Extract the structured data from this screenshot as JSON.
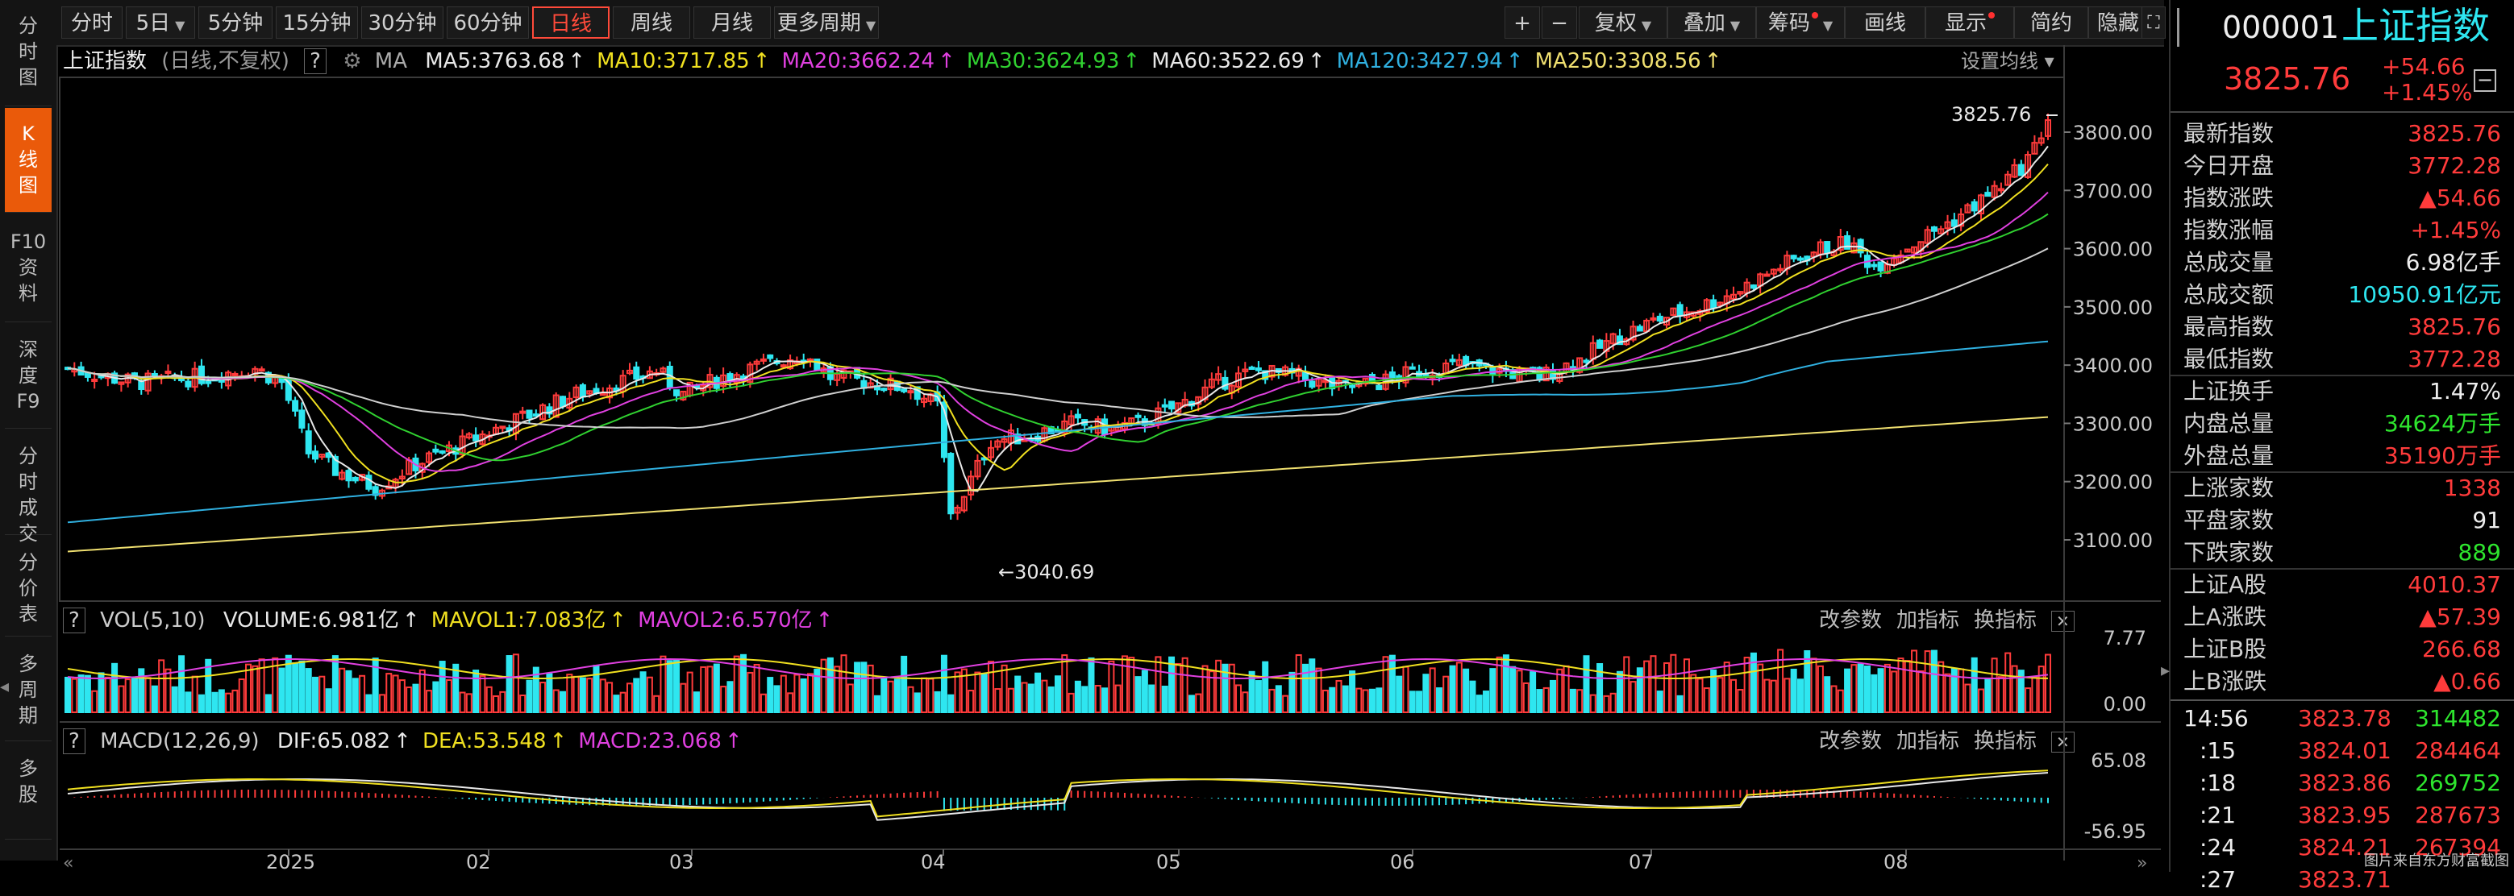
{
  "left_tabs": [
    {
      "label": "分时图",
      "active": false
    },
    {
      "label": "K线图",
      "active": true
    },
    {
      "label": "F10资料",
      "active": false
    },
    {
      "label": "深度F9",
      "active": false
    },
    {
      "label": "分时成交",
      "active": false
    },
    {
      "label": "分价表",
      "active": false
    },
    {
      "label": "多周期",
      "active": false
    },
    {
      "label": "多股",
      "active": false
    }
  ],
  "toolbar": {
    "periods": [
      "分时",
      "5日",
      "5分钟",
      "15分钟",
      "30分钟",
      "60分钟",
      "日线",
      "周线",
      "月线",
      "更多周期"
    ],
    "active_period": "日线",
    "tools": [
      "复权",
      "叠加",
      "筹码",
      "画线",
      "显示",
      "简约",
      "隐藏"
    ],
    "plus": "+",
    "minus": "−"
  },
  "main_chart": {
    "name": "上证指数",
    "mode": "(日线,不复权)",
    "help": "?",
    "ma_label": "MA",
    "ma_items": [
      {
        "text": "MA5:3763.68",
        "color": "#e8e8e8"
      },
      {
        "text": "MA10:3717.85",
        "color": "#f0e020"
      },
      {
        "text": "MA20:3662.24",
        "color": "#e040e0"
      },
      {
        "text": "MA30:3624.93",
        "color": "#30d030"
      },
      {
        "text": "MA60:3522.69",
        "color": "#e8e8e8"
      },
      {
        "text": "MA120:3427.94",
        "color": "#30b0e0"
      },
      {
        "text": "MA250:3308.56",
        "color": "#f0e070"
      }
    ],
    "settings_label": "设置均线",
    "high_label": "3825.76",
    "low_label": "3040.69",
    "y_ticks": [
      "3800.00",
      "3700.00",
      "3600.00",
      "3500.00",
      "3400.00",
      "3300.00",
      "3200.00",
      "3100.00"
    ]
  },
  "vol_panel": {
    "help": "?",
    "title": "VOL(5,10)",
    "items": [
      {
        "text": "VOLUME:6.981亿",
        "color": "#e8e8e8"
      },
      {
        "text": "MAVOL1:7.083亿",
        "color": "#f0e020"
      },
      {
        "text": "MAVOL2:6.570亿",
        "color": "#e040e0"
      }
    ],
    "buttons": [
      "改参数",
      "加指标",
      "换指标"
    ],
    "y_ticks": [
      "7.77",
      "0.00"
    ]
  },
  "macd_panel": {
    "help": "?",
    "title": "MACD(12,26,9)",
    "items": [
      {
        "text": "DIF:65.082",
        "color": "#e8e8e8"
      },
      {
        "text": "DEA:53.548",
        "color": "#f0e020"
      },
      {
        "text": "MACD:23.068",
        "color": "#e040e0"
      }
    ],
    "buttons": [
      "改参数",
      "加指标",
      "换指标"
    ],
    "y_ticks": [
      "65.08",
      "-56.95"
    ]
  },
  "x_axis": [
    "2025",
    "02",
    "03",
    "04",
    "05",
    "06",
    "07",
    "08"
  ],
  "right_panel": {
    "code": "000001",
    "name": "上证指数",
    "price": "3825.76",
    "change": "+54.66",
    "change_pct": "+1.45%",
    "stats": [
      {
        "label": "最新指数",
        "value": "3825.76",
        "color": "red"
      },
      {
        "label": "今日开盘",
        "value": "3772.28",
        "color": "red"
      },
      {
        "label": "指数涨跌",
        "value": "▲54.66",
        "color": "red"
      },
      {
        "label": "指数涨幅",
        "value": "+1.45%",
        "color": "red"
      },
      {
        "label": "总成交量",
        "value": "6.98亿手",
        "color": "white"
      },
      {
        "label": "总成交额",
        "value": "10950.91亿元",
        "color": "cyan"
      },
      {
        "label": "最高指数",
        "value": "3825.76",
        "color": "red"
      },
      {
        "label": "最低指数",
        "value": "3772.28",
        "color": "red"
      },
      {
        "label": "上证换手",
        "value": "1.47%",
        "color": "white"
      },
      {
        "label": "内盘总量",
        "value": "34624万手",
        "color": "green"
      },
      {
        "label": "外盘总量",
        "value": "35190万手",
        "color": "red"
      },
      {
        "label": "上涨家数",
        "value": "1338",
        "color": "red"
      },
      {
        "label": "平盘家数",
        "value": "91",
        "color": "white"
      },
      {
        "label": "下跌家数",
        "value": "889",
        "color": "green"
      },
      {
        "label": "上证A股",
        "value": "4010.37",
        "color": "red"
      },
      {
        "label": "上A涨跌",
        "value": "▲57.39",
        "color": "red"
      },
      {
        "label": "上证B股",
        "value": "266.68",
        "color": "red"
      },
      {
        "label": "上B涨跌",
        "value": "▲0.66",
        "color": "red"
      }
    ],
    "ticks": [
      {
        "time": "14:56",
        "price": "3823.78",
        "vol": "314482",
        "vol_color": "green"
      },
      {
        "time": ":15",
        "price": "3824.01",
        "vol": "284464",
        "vol_color": "red"
      },
      {
        "time": ":18",
        "price": "3823.86",
        "vol": "269752",
        "vol_color": "green"
      },
      {
        "time": ":21",
        "price": "3823.95",
        "vol": "287673",
        "vol_color": "red"
      },
      {
        "time": ":24",
        "price": "3824.21",
        "vol": "267394",
        "vol_color": "red"
      },
      {
        "time": ":27",
        "price": "3823.71",
        "vol": "",
        "vol_color": "red"
      }
    ],
    "watermark": "图片来自东方财富截图"
  }
}
